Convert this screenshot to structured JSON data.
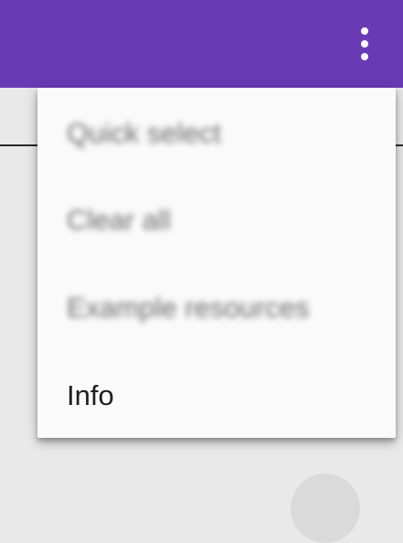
{
  "app_bar": {
    "color": "#6a3ab5",
    "overflow_icon": "more-vert-icon"
  },
  "menu": {
    "items": [
      {
        "label": "Quick select",
        "blurred": true
      },
      {
        "label": "Clear all",
        "blurred": true
      },
      {
        "label": "Example resources",
        "blurred": true
      },
      {
        "label": "Info",
        "blurred": false
      }
    ]
  }
}
